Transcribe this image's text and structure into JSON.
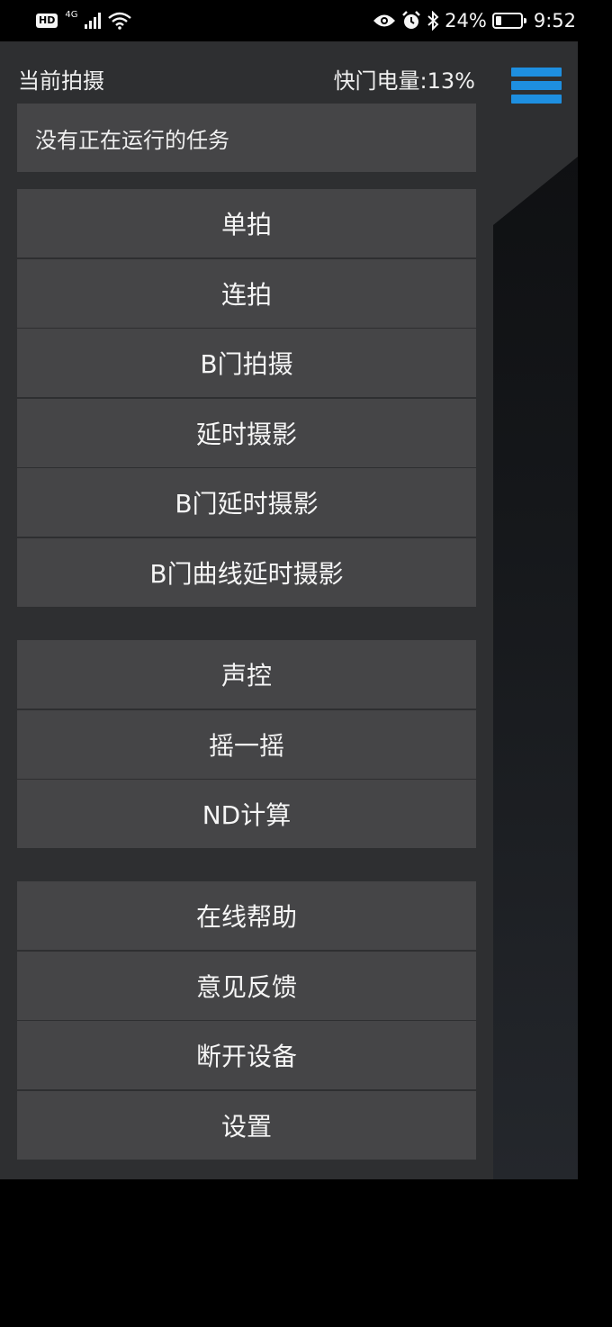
{
  "status_bar": {
    "left_badge": "HD",
    "network": "4G",
    "battery_percent": "24%",
    "battery_level": 0.24,
    "time": "9:52"
  },
  "header": {
    "current_mode_label": "当前拍摄",
    "shutter_battery": "快门电量:13%"
  },
  "task_status": "没有正在运行的任务",
  "groups": [
    {
      "items": [
        "单拍",
        "连拍",
        "B门拍摄",
        "延时摄影",
        "B门延时摄影",
        "B门曲线延时摄影"
      ]
    },
    {
      "items": [
        "声控",
        "摇一摇",
        "ND计算"
      ]
    },
    {
      "items": [
        "在线帮助",
        "意见反馈",
        "断开设备",
        "设置"
      ]
    }
  ],
  "colors": {
    "accent": "#1e8fe0",
    "panel": "#2e2f31",
    "item": "#454547"
  }
}
